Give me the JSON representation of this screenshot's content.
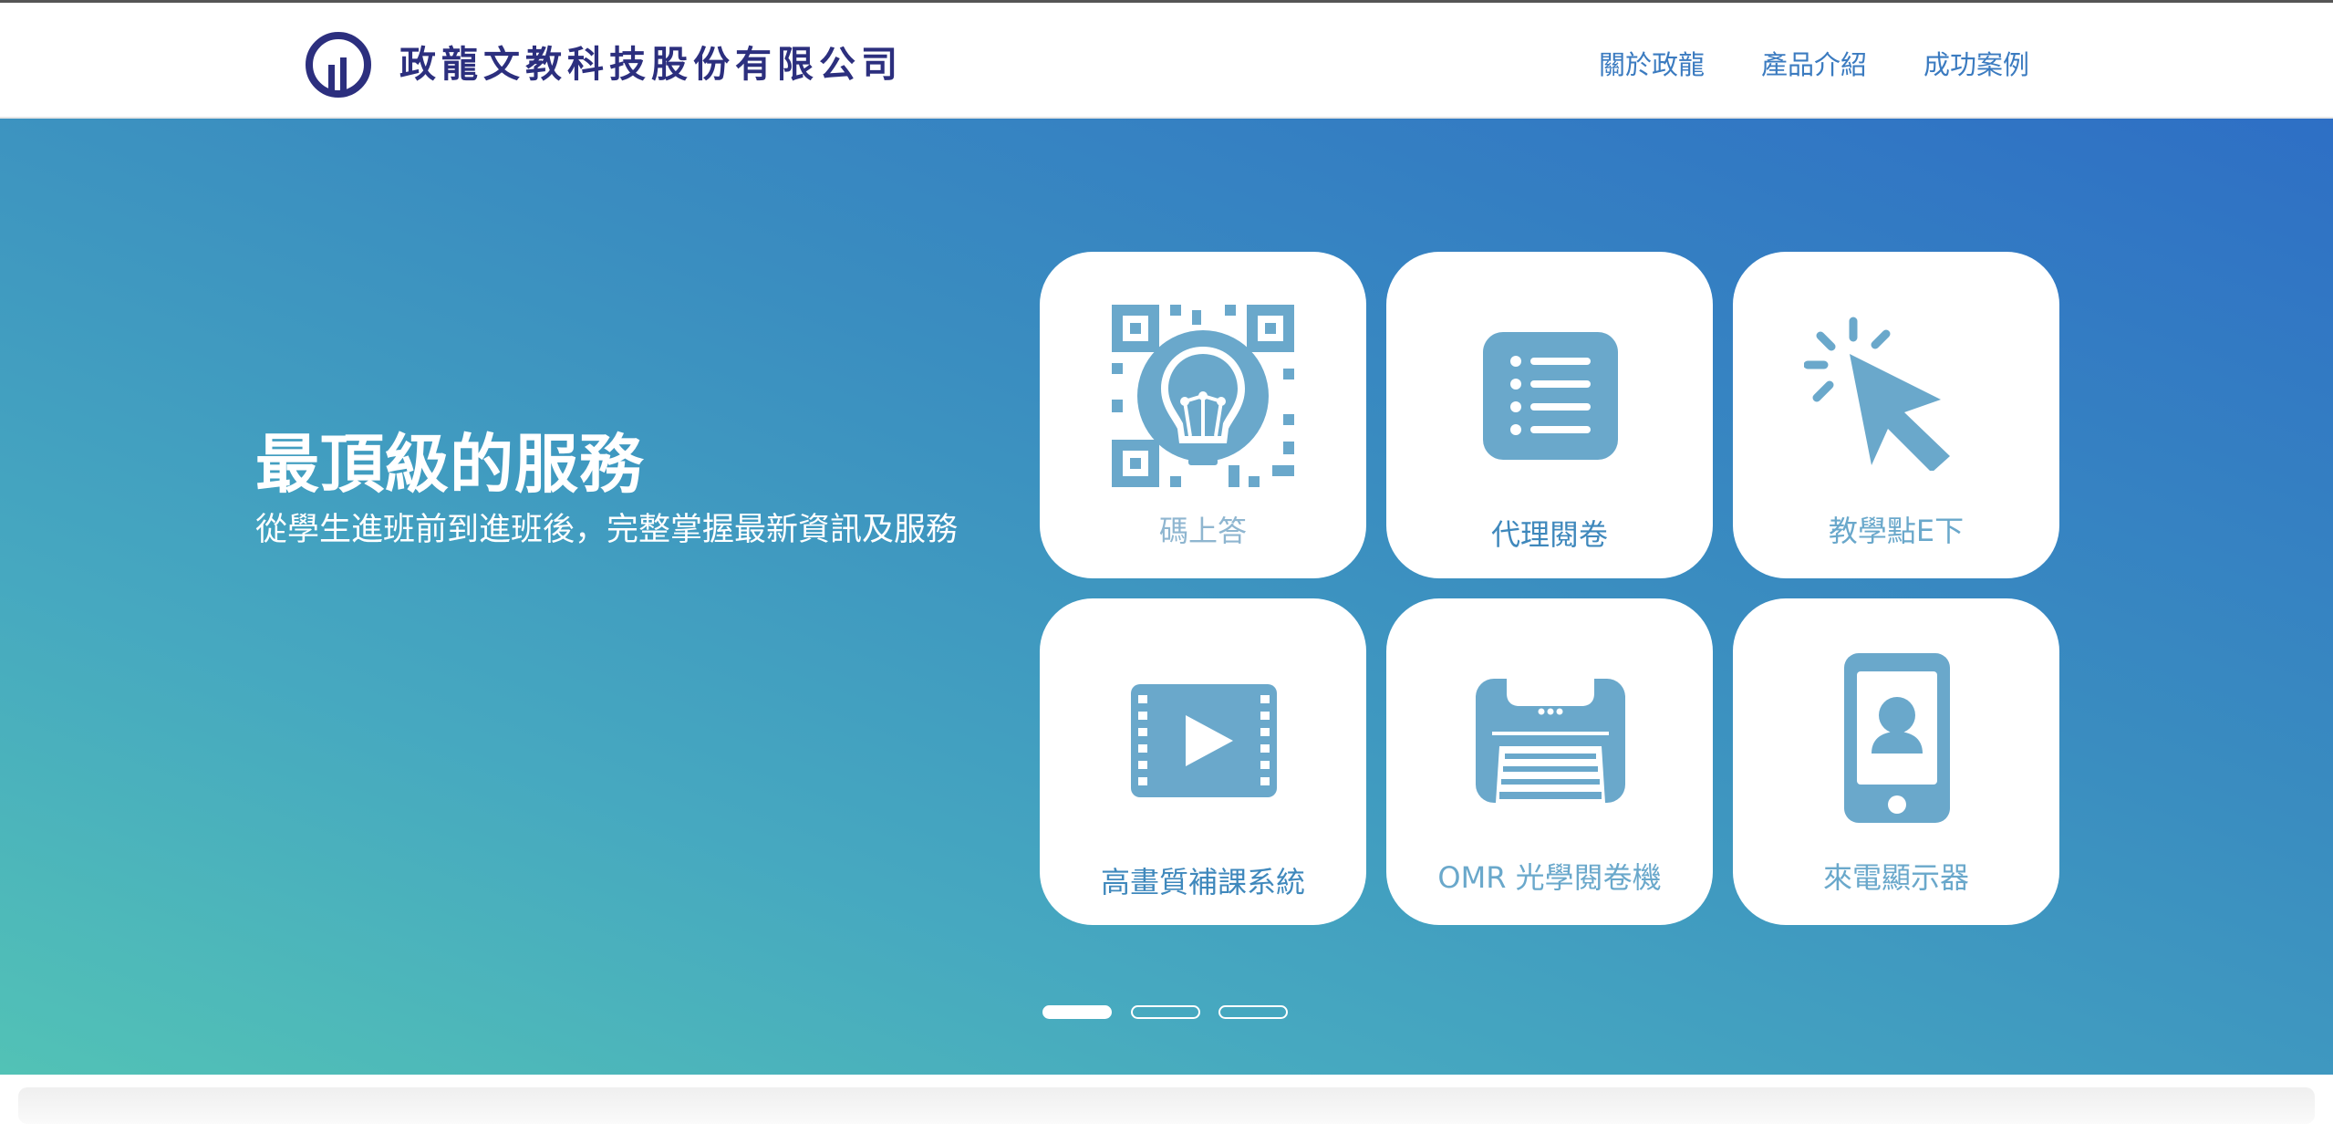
{
  "header": {
    "company_name": "政龍文教科技股份有限公司",
    "logo_color": "#2c2f7e",
    "nav": [
      {
        "label": "關於政龍"
      },
      {
        "label": "產品介紹"
      },
      {
        "label": "成功案例"
      }
    ]
  },
  "hero": {
    "title": "最頂級的服務",
    "subtitle": "從學生進班前到進班後，完整掌握最新資訊及服務",
    "gradient": [
      "#2e6fc5",
      "#52c2b6"
    ]
  },
  "products": [
    {
      "label": "碼上答",
      "icon": "qr-lightbulb-icon"
    },
    {
      "label": "代理閱卷",
      "icon": "list-icon"
    },
    {
      "label": "教學點E下",
      "icon": "cursor-click-icon"
    },
    {
      "label": "高畫質補課系統",
      "icon": "video-play-icon"
    },
    {
      "label": "OMR 光學閱卷機",
      "icon": "scanner-icon"
    },
    {
      "label": "來電顯示器",
      "icon": "phone-contact-icon"
    }
  ],
  "carousel": {
    "slides": 3,
    "active": 1
  },
  "colors": {
    "icon": "#6aa8cb",
    "label": "#3f88bc",
    "label_muted": "#8fb6d0"
  }
}
